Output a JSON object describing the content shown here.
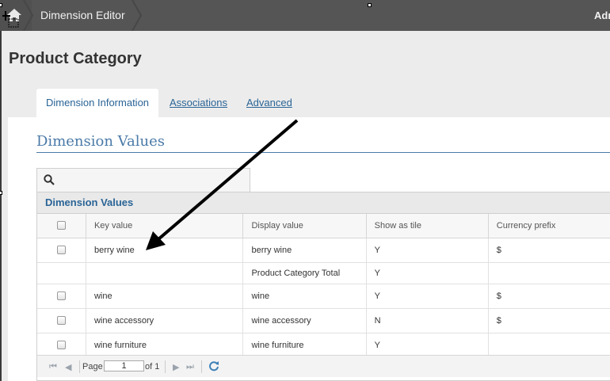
{
  "header": {
    "breadcrumb": "Dimension Editor",
    "user": "Adm"
  },
  "page": {
    "title": "Product Category"
  },
  "tabs": [
    {
      "label": "Dimension Information",
      "active": true
    },
    {
      "label": "Associations",
      "active": false
    },
    {
      "label": "Advanced",
      "active": false
    }
  ],
  "section": {
    "title": "Dimension Values"
  },
  "grid": {
    "title": "Dimension Values",
    "columns": [
      "Key value",
      "Display value",
      "Show as tile",
      "Currency prefix"
    ],
    "rows": [
      {
        "key": "berry wine",
        "display": "berry wine",
        "tile": "Y",
        "currency": "$",
        "checkbox": true
      },
      {
        "key": "",
        "display": "Product Category Total",
        "tile": "Y",
        "currency": "",
        "checkbox": false
      },
      {
        "key": "wine",
        "display": "wine",
        "tile": "Y",
        "currency": "$",
        "checkbox": true
      },
      {
        "key": "wine accessory",
        "display": "wine accessory",
        "tile": "N",
        "currency": "$",
        "checkbox": true
      },
      {
        "key": "wine furniture",
        "display": "wine furniture",
        "tile": "Y",
        "currency": "",
        "checkbox": true
      }
    ]
  },
  "pager": {
    "page_label": "Page",
    "page_value": "1",
    "of_label": "of 1"
  },
  "icons": {
    "home": "home-icon",
    "search": "search-icon",
    "refresh": "refresh-icon"
  },
  "colors": {
    "accent": "#2a6496",
    "topbar": "#555555"
  }
}
